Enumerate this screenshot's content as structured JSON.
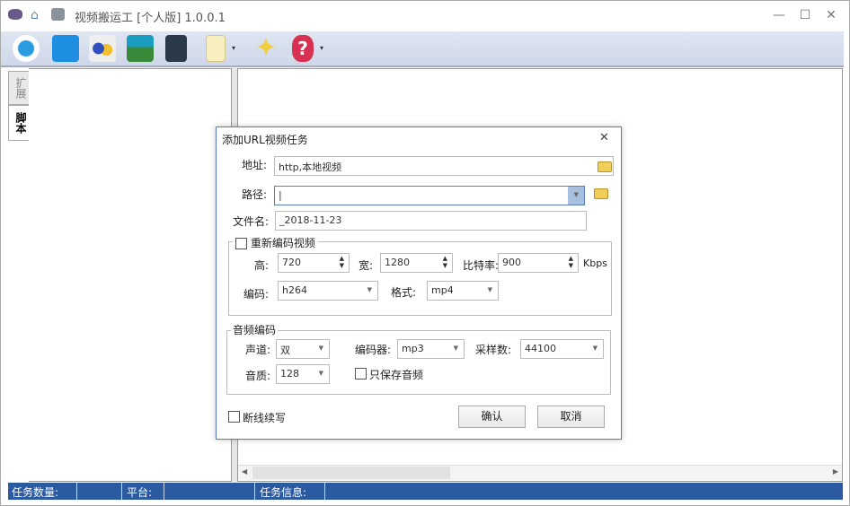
{
  "window": {
    "title": "视频搬运工 [个人版] 1.0.0.1",
    "min": "—",
    "max": "☐",
    "close": "✕"
  },
  "toolbar": {
    "dropdown_caret": "▾"
  },
  "side_tabs": [
    "扩展",
    "脚本"
  ],
  "status": {
    "task_count": "任务数量:",
    "platform": "平台:",
    "task_info": "任务信息:"
  },
  "dialog": {
    "title": "添加URL视频任务",
    "close": "✕",
    "address_label": "地址:",
    "address_value": "http,本地视频",
    "path_label": "路径:",
    "path_value": "",
    "filename_label": "文件名:",
    "filename_value": "_2018-11-23",
    "reencode_label": "重新编码视频",
    "height_label": "高:",
    "height_value": "720",
    "width_label": "宽:",
    "width_value": "1280",
    "bitrate_label": "比特率:",
    "bitrate_value": "900",
    "bitrate_unit": "Kbps",
    "codec_label": "编码:",
    "codec_value": "h264",
    "format_label": "格式:",
    "format_value": "mp4",
    "audio_group": "音频编码",
    "channel_label": "声道:",
    "channel_value": "双",
    "encoder_label": "编码器:",
    "encoder_value": "mp3",
    "samplerate_label": "采样数:",
    "samplerate_value": "44100",
    "quality_label": "音质:",
    "quality_value": "128",
    "audio_only_label": "只保存音频",
    "resume_label": "断线续写",
    "ok": "确认",
    "cancel": "取消"
  }
}
